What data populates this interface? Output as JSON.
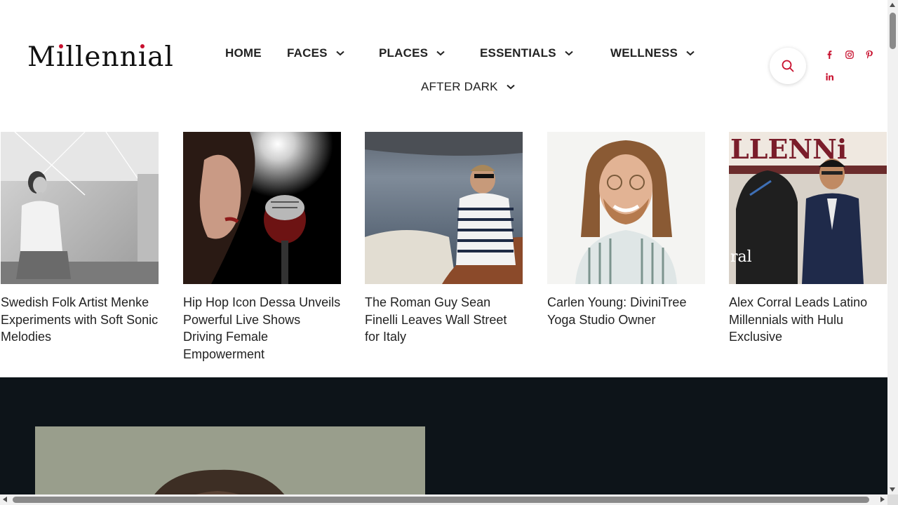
{
  "brand": {
    "logo_text": "Millennial",
    "accent_color": "#c8102e"
  },
  "nav": {
    "items": [
      {
        "label": "HOME",
        "has_dropdown": false
      },
      {
        "label": "FACES",
        "has_dropdown": true
      },
      {
        "label": "PLACES",
        "has_dropdown": true
      },
      {
        "label": "ESSENTIALS",
        "has_dropdown": true
      },
      {
        "label": "WELLNESS",
        "has_dropdown": true
      },
      {
        "label": "AFTER DARK",
        "has_dropdown": true
      }
    ]
  },
  "header_actions": {
    "search_icon": "search-icon",
    "social_icons": [
      "facebook-icon",
      "instagram-icon",
      "pinterest-icon",
      "linkedin-icon"
    ]
  },
  "articles": [
    {
      "title": "Swedish Folk Artist Menke Experiments with Soft Sonic Melodies",
      "image": "woman-sitting-bw-photo"
    },
    {
      "title": "Hip Hop Icon Dessa Unveils Powerful Live Shows Driving Female Empowerment",
      "image": "woman-vintage-microphone-photo"
    },
    {
      "title": "The Roman Guy Sean Finelli Leaves Wall Street for Italy",
      "image": "man-on-boat-photo"
    },
    {
      "title": "Carlen Young: DiviniTree Yoga Studio Owner",
      "image": "smiling-man-portrait-photo"
    },
    {
      "title": "Alex Corral Leads Latino Millennials with Hulu Exclusive",
      "image": "man-with-horse-cover-photo"
    }
  ],
  "feature": {
    "background_color": "#0d1419",
    "image": "featured-portrait-photo"
  }
}
